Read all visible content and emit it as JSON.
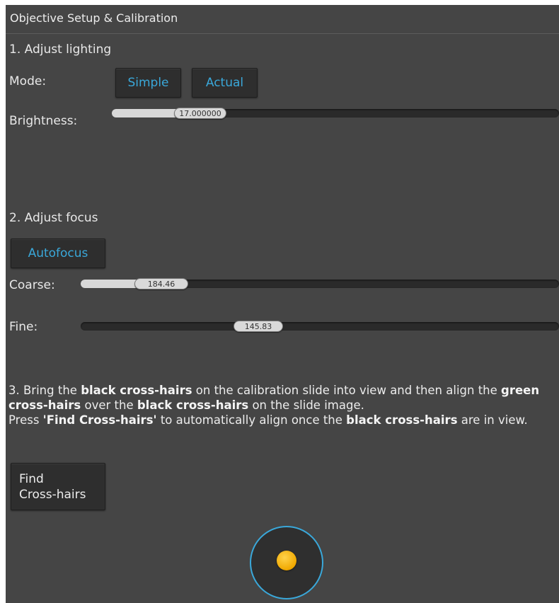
{
  "panel": {
    "title": "Objective Setup & Calibration"
  },
  "lighting": {
    "heading": "1. Adjust lighting",
    "mode_label": "Mode:",
    "mode_options": [
      "Simple",
      "Actual"
    ],
    "mode_selected": "Simple",
    "brightness_label": "Brightness:",
    "brightness_value": "17.000000",
    "brightness_fraction": 0.17
  },
  "focus": {
    "heading": "2. Adjust focus",
    "autofocus_label": "Autofocus",
    "coarse_label": "Coarse:",
    "coarse_value": "184.46",
    "coarse_fraction": 0.18,
    "fine_label": "Fine:",
    "fine_value": "145.83",
    "fine_fraction": 0.41
  },
  "crosshairs": {
    "heading_parts": [
      "3. Bring the ",
      "black cross-hairs",
      " on the calibration slide into view and then align the ",
      "green cross-hairs",
      " over the ",
      "black cross-hairs",
      " on the slide image."
    ],
    "press_parts": [
      "Press ",
      "'Find Cross-hairs'",
      " to automatically align once the ",
      "black cross-hairs",
      " are in view."
    ],
    "button_line1": "Find",
    "button_line2": "Cross-hairs"
  },
  "colors": {
    "panel_bg": "#454545",
    "accent_blue": "#3aa8da",
    "joystick_dot": "#f0a800"
  },
  "icons": {
    "joystick": "joystick-knob-icon"
  }
}
